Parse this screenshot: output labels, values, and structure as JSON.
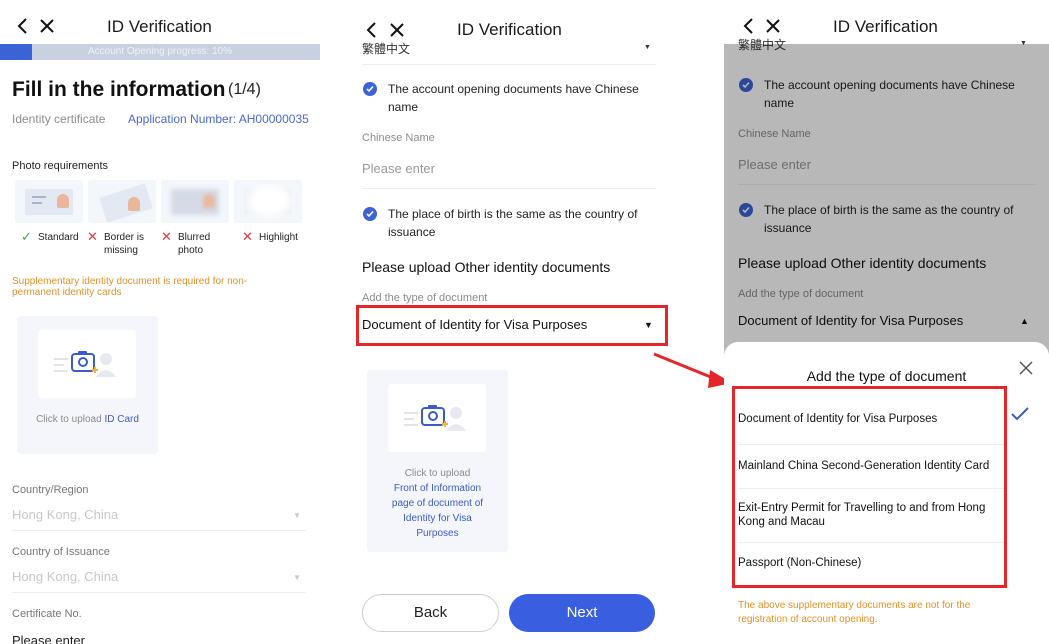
{
  "colors": {
    "accent": "#3b63d6",
    "warning": "#e0922c",
    "highlight_box": "#e4262b"
  },
  "panel1": {
    "title": "ID Verification",
    "progress_text": "Account Opening progress: 10%",
    "progress_fraction": 0.1,
    "heading": "Fill in the information",
    "step": "(1/4)",
    "identity_label": "Identity certificate",
    "application_number": "Application Number: AH00000035",
    "photo_requirements": "Photo requirements",
    "examples": [
      {
        "label": "Standard",
        "ok": true,
        "icon": "check-icon"
      },
      {
        "label": "Border is missing",
        "ok": false,
        "icon": "cross-icon"
      },
      {
        "label": "Blurred photo",
        "ok": false,
        "icon": "cross-icon"
      },
      {
        "label": "Highlight",
        "ok": false,
        "icon": "cross-icon"
      }
    ],
    "warning": "Supplementary identity document is required for non-permanent identity cards",
    "upload_prefix": "Click to upload ",
    "upload_link": "ID Card",
    "country_label": "Country/Region",
    "country_value": "Hong Kong, China",
    "issuance_label": "Country of Issuance",
    "issuance_value": "Hong Kong, China",
    "cert_label": "Certificate No.",
    "cert_placeholder": "Please enter"
  },
  "panel2": {
    "title": "ID Verification",
    "language_value": "繁體中文",
    "check1": "The account opening documents have Chinese name",
    "chinese_name_label": "Chinese Name",
    "chinese_name_placeholder": "Please enter",
    "check2": "The place of birth is the same as the country of issuance",
    "upload_title": "Please upload Other identity documents",
    "doc_type_label": "Add the type of document",
    "doc_type_value": "Document of Identity for Visa Purposes",
    "upload_prefix": "Click to upload",
    "upload_link": "Front of Information page of document of Identity for Visa Purposes",
    "back_label": "Back",
    "next_label": "Next"
  },
  "panel3": {
    "title": "ID Verification",
    "language_value": "繁體中文",
    "check1": "The account opening documents have Chinese name",
    "chinese_name_label": "Chinese Name",
    "chinese_name_placeholder": "Please enter",
    "check2": "The place of birth is the same as the country of issuance",
    "upload_title": "Please upload Other identity documents",
    "doc_type_label": "Add the type of document",
    "doc_type_value": "Document of Identity for Visa Purposes",
    "sheet_title": "Add the type of document",
    "options": [
      "Document of Identity for Visa Purposes",
      "Mainland China Second-Generation Identity Card",
      "Exit-Entry Permit for Travelling to and from Hong Kong and Macau",
      "Passport (Non-Chinese)"
    ],
    "selected_index": 0,
    "note": "The above supplementary documents are not for the registration of account opening."
  }
}
